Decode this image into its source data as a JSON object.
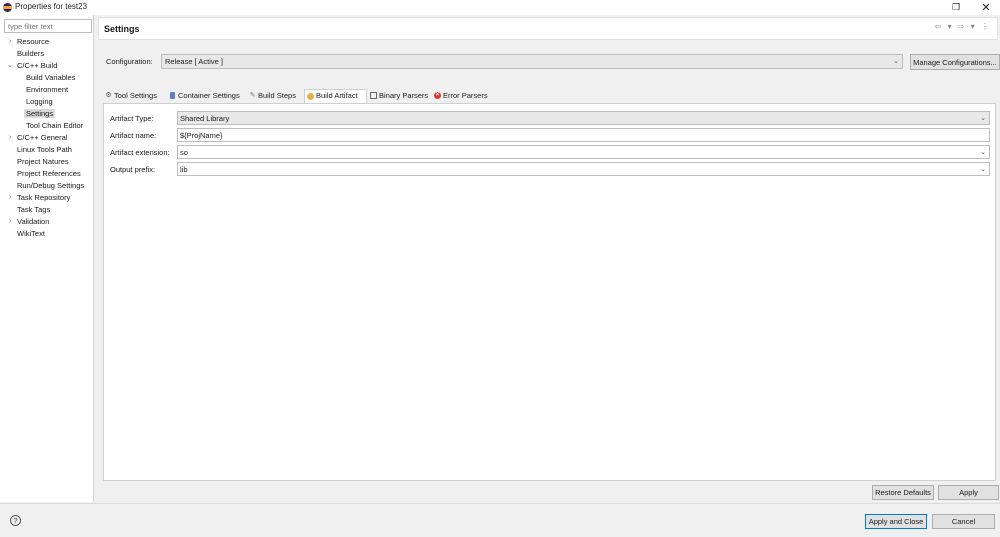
{
  "window": {
    "title": "Properties for test23"
  },
  "sidebar": {
    "filter_placeholder": "type filter text",
    "items": [
      {
        "label": "Resource",
        "chevron": "›"
      },
      {
        "label": "Builders",
        "chevron": ""
      },
      {
        "label": "C/C++ Build",
        "chevron": "⌄"
      },
      {
        "label": "Build Variables",
        "chevron": ""
      },
      {
        "label": "Environment",
        "chevron": ""
      },
      {
        "label": "Logging",
        "chevron": ""
      },
      {
        "label": "Settings",
        "chevron": ""
      },
      {
        "label": "Tool Chain Editor",
        "chevron": ""
      },
      {
        "label": "C/C++ General",
        "chevron": "›"
      },
      {
        "label": "Linux Tools Path",
        "chevron": ""
      },
      {
        "label": "Project Natures",
        "chevron": ""
      },
      {
        "label": "Project References",
        "chevron": ""
      },
      {
        "label": "Run/Debug Settings",
        "chevron": ""
      },
      {
        "label": "Task Repository",
        "chevron": "›"
      },
      {
        "label": "Task Tags",
        "chevron": ""
      },
      {
        "label": "Validation",
        "chevron": "›"
      },
      {
        "label": "WikiText",
        "chevron": ""
      }
    ]
  },
  "header": {
    "title": "Settings",
    "nav_glyphs": "⇦ ▾ ⇨ ▾ ⋮"
  },
  "configuration": {
    "label": "Configuration:",
    "value": "Release  [ Active ]",
    "manage_label": "Manage Configurations..."
  },
  "tabs": [
    {
      "label": "Tool Settings",
      "icon": "gear-icon"
    },
    {
      "label": "Container Settings",
      "icon": "container-icon"
    },
    {
      "label": "Build Steps",
      "icon": "wrench-icon"
    },
    {
      "label": "Build Artifact",
      "icon": "artifact-icon",
      "active": true
    },
    {
      "label": "Binary Parsers",
      "icon": "binary-icon"
    },
    {
      "label": "Error Parsers",
      "icon": "error-icon"
    }
  ],
  "artifact": {
    "type_label": "Artifact Type:",
    "type_value": "Shared Library",
    "name_label": "Artifact name:",
    "name_value": "${ProjName}",
    "ext_label": "Artifact extension:",
    "ext_value": "so",
    "prefix_label": "Output prefix:",
    "prefix_value": "lib"
  },
  "buttons": {
    "restore_defaults": "Restore Defaults",
    "apply": "Apply",
    "apply_close": "Apply and Close",
    "cancel": "Cancel",
    "help": "?"
  },
  "colors": {
    "accent": "#0078d7",
    "selected_bg": "#d9d9d9"
  }
}
